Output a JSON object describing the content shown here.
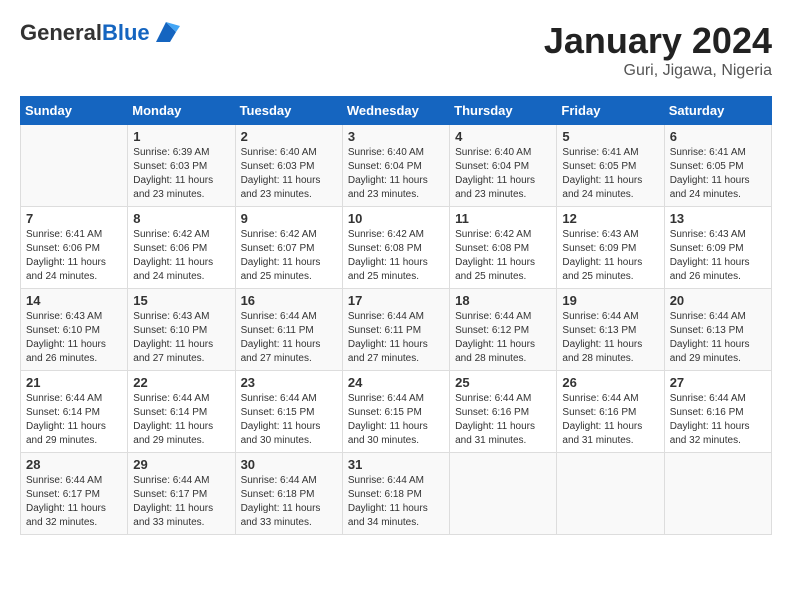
{
  "header": {
    "logo_general": "General",
    "logo_blue": "Blue",
    "title": "January 2024",
    "subtitle": "Guri, Jigawa, Nigeria"
  },
  "days_of_week": [
    "Sunday",
    "Monday",
    "Tuesday",
    "Wednesday",
    "Thursday",
    "Friday",
    "Saturday"
  ],
  "weeks": [
    [
      {
        "day": "",
        "content": ""
      },
      {
        "day": "1",
        "content": "Sunrise: 6:39 AM\nSunset: 6:03 PM\nDaylight: 11 hours and 23 minutes."
      },
      {
        "day": "2",
        "content": "Sunrise: 6:40 AM\nSunset: 6:03 PM\nDaylight: 11 hours and 23 minutes."
      },
      {
        "day": "3",
        "content": "Sunrise: 6:40 AM\nSunset: 6:04 PM\nDaylight: 11 hours and 23 minutes."
      },
      {
        "day": "4",
        "content": "Sunrise: 6:40 AM\nSunset: 6:04 PM\nDaylight: 11 hours and 23 minutes."
      },
      {
        "day": "5",
        "content": "Sunrise: 6:41 AM\nSunset: 6:05 PM\nDaylight: 11 hours and 24 minutes."
      },
      {
        "day": "6",
        "content": "Sunrise: 6:41 AM\nSunset: 6:05 PM\nDaylight: 11 hours and 24 minutes."
      }
    ],
    [
      {
        "day": "7",
        "content": "Sunrise: 6:41 AM\nSunset: 6:06 PM\nDaylight: 11 hours and 24 minutes."
      },
      {
        "day": "8",
        "content": "Sunrise: 6:42 AM\nSunset: 6:06 PM\nDaylight: 11 hours and 24 minutes."
      },
      {
        "day": "9",
        "content": "Sunrise: 6:42 AM\nSunset: 6:07 PM\nDaylight: 11 hours and 25 minutes."
      },
      {
        "day": "10",
        "content": "Sunrise: 6:42 AM\nSunset: 6:08 PM\nDaylight: 11 hours and 25 minutes."
      },
      {
        "day": "11",
        "content": "Sunrise: 6:42 AM\nSunset: 6:08 PM\nDaylight: 11 hours and 25 minutes."
      },
      {
        "day": "12",
        "content": "Sunrise: 6:43 AM\nSunset: 6:09 PM\nDaylight: 11 hours and 25 minutes."
      },
      {
        "day": "13",
        "content": "Sunrise: 6:43 AM\nSunset: 6:09 PM\nDaylight: 11 hours and 26 minutes."
      }
    ],
    [
      {
        "day": "14",
        "content": "Sunrise: 6:43 AM\nSunset: 6:10 PM\nDaylight: 11 hours and 26 minutes."
      },
      {
        "day": "15",
        "content": "Sunrise: 6:43 AM\nSunset: 6:10 PM\nDaylight: 11 hours and 27 minutes."
      },
      {
        "day": "16",
        "content": "Sunrise: 6:44 AM\nSunset: 6:11 PM\nDaylight: 11 hours and 27 minutes."
      },
      {
        "day": "17",
        "content": "Sunrise: 6:44 AM\nSunset: 6:11 PM\nDaylight: 11 hours and 27 minutes."
      },
      {
        "day": "18",
        "content": "Sunrise: 6:44 AM\nSunset: 6:12 PM\nDaylight: 11 hours and 28 minutes."
      },
      {
        "day": "19",
        "content": "Sunrise: 6:44 AM\nSunset: 6:13 PM\nDaylight: 11 hours and 28 minutes."
      },
      {
        "day": "20",
        "content": "Sunrise: 6:44 AM\nSunset: 6:13 PM\nDaylight: 11 hours and 29 minutes."
      }
    ],
    [
      {
        "day": "21",
        "content": "Sunrise: 6:44 AM\nSunset: 6:14 PM\nDaylight: 11 hours and 29 minutes."
      },
      {
        "day": "22",
        "content": "Sunrise: 6:44 AM\nSunset: 6:14 PM\nDaylight: 11 hours and 29 minutes."
      },
      {
        "day": "23",
        "content": "Sunrise: 6:44 AM\nSunset: 6:15 PM\nDaylight: 11 hours and 30 minutes."
      },
      {
        "day": "24",
        "content": "Sunrise: 6:44 AM\nSunset: 6:15 PM\nDaylight: 11 hours and 30 minutes."
      },
      {
        "day": "25",
        "content": "Sunrise: 6:44 AM\nSunset: 6:16 PM\nDaylight: 11 hours and 31 minutes."
      },
      {
        "day": "26",
        "content": "Sunrise: 6:44 AM\nSunset: 6:16 PM\nDaylight: 11 hours and 31 minutes."
      },
      {
        "day": "27",
        "content": "Sunrise: 6:44 AM\nSunset: 6:16 PM\nDaylight: 11 hours and 32 minutes."
      }
    ],
    [
      {
        "day": "28",
        "content": "Sunrise: 6:44 AM\nSunset: 6:17 PM\nDaylight: 11 hours and 32 minutes."
      },
      {
        "day": "29",
        "content": "Sunrise: 6:44 AM\nSunset: 6:17 PM\nDaylight: 11 hours and 33 minutes."
      },
      {
        "day": "30",
        "content": "Sunrise: 6:44 AM\nSunset: 6:18 PM\nDaylight: 11 hours and 33 minutes."
      },
      {
        "day": "31",
        "content": "Sunrise: 6:44 AM\nSunset: 6:18 PM\nDaylight: 11 hours and 34 minutes."
      },
      {
        "day": "",
        "content": ""
      },
      {
        "day": "",
        "content": ""
      },
      {
        "day": "",
        "content": ""
      }
    ]
  ]
}
